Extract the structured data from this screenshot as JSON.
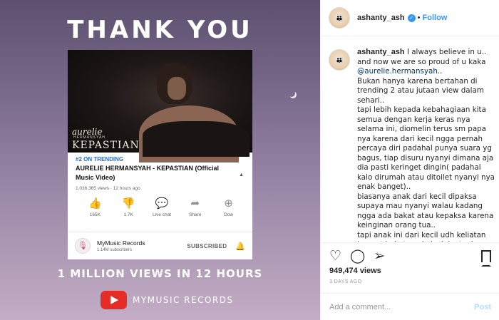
{
  "post_image": {
    "headline": "THANK YOU",
    "video": {
      "artist_overlay": "aurelie",
      "artist_overlay_sub": "HERMANSYAH",
      "title_overlay": "KEPASTIAN",
      "trending_tag": "#2 ON TRENDING",
      "title": "AURELIE HERMANSYAH - KEPASTIAN (Official Music Video)",
      "meta": "1,036,365 views · 12 hours ago",
      "actions": [
        {
          "icon": "thumbs-up-icon",
          "glyph": "👍",
          "label": "165K",
          "active": true
        },
        {
          "icon": "thumbs-down-icon",
          "glyph": "👎",
          "label": "1.7K",
          "active": false
        },
        {
          "icon": "live-chat-icon",
          "glyph": "💬",
          "label": "Live chat",
          "active": false
        },
        {
          "icon": "share-icon",
          "glyph": "➦",
          "label": "Share",
          "active": false
        },
        {
          "icon": "download-icon",
          "glyph": "⊕",
          "label": "Dow",
          "active": false
        }
      ],
      "channel": {
        "name": "MyMusic Records",
        "subscribers": "1.14M subscribers",
        "subscribed_label": "SUBSCRIBED"
      }
    },
    "caption": "1 MILLION VIEWS IN 12 HOURS",
    "brand": "MYMUSIC RECORDS",
    "colors": {
      "youtube_red": "#e52d27",
      "trend_blue": "#2a6ec7"
    }
  },
  "panel": {
    "header": {
      "username": "ashanty_ash",
      "verified": true,
      "follow_label": "Follow"
    },
    "caption_username": "ashanty_ash",
    "caption_intro": "I always believe in u.. and now we are so proud of u kaka",
    "caption_mention": "@aurelie.hermansyah",
    "caption_after_mention": "..",
    "caption_body": "Bukan hanya karena bertahan di trending 2 atau jutaan view dalam sehari..\ntapi lebih kepada kebahagiaan kita semua dengan kerja keras nya selama ini, diomelin terus sm papa nya karena dari kecil ngga pernah percaya diri padahal punya suara yg bagus, tiap disuru nyanyi dimana aja dia pasti keringet dingin( padahal kalo dirumah atau ditoilet nyanyi nya enak banget)..\nbiasanya anak dari kecil dipaksa supaya mau nyanyi walau kadang ngga ada bakat atau kepaksa karena keinginan orang tua..\ntapi anak ini dari kecil udh keliatan banget bakatnya kaka loly, tapi selalu",
    "likes": "949,474 views",
    "timestamp": "3 DAYS AGO",
    "comment_placeholder": "Add a comment...",
    "post_label": "Post",
    "colors": {
      "link": "#3897f0",
      "mention": "#003569"
    }
  }
}
